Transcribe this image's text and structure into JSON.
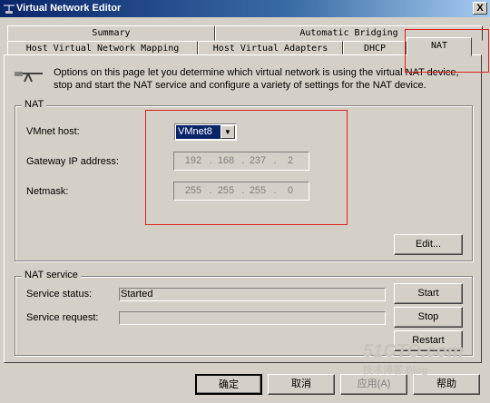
{
  "window": {
    "title": "Virtual Network Editor",
    "close_glyph": "X"
  },
  "tabs_row1": [
    "Summary",
    "Automatic Bridging"
  ],
  "tabs_row2": [
    "Host Virtual Network Mapping",
    "Host Virtual Adapters",
    "DHCP",
    "NAT"
  ],
  "intro": {
    "text": "Options on this page let you determine which virtual network is using the virtual NAT device, stop and start the NAT service and configure a variety of settings for the NAT device."
  },
  "nat_group": {
    "title": "NAT",
    "vmnet_label": "VMnet host:",
    "vmnet_value": "VMnet8",
    "gateway_label": "Gateway IP address:",
    "gateway": [
      "192",
      "168",
      "237",
      "2"
    ],
    "netmask_label": "Netmask:",
    "netmask": [
      "255",
      "255",
      "255",
      "0"
    ],
    "edit_button": "Edit..."
  },
  "service_group": {
    "title": "NAT service",
    "status_label": "Service status:",
    "status_value": "Started",
    "request_label": "Service request:",
    "request_value": "",
    "start_button": "Start",
    "stop_button": "Stop",
    "restart_button": "Restart"
  },
  "footer": {
    "ok": "确定",
    "cancel": "取消",
    "apply": "应用(A)",
    "help": "帮助"
  },
  "watermark": {
    "line1": "51CTO.com",
    "line2": "技术博客 Blog"
  },
  "colors": {
    "face": "#d4d0c8",
    "title_start": "#0a246a",
    "selection": "#0a246a",
    "annotation": "#e02020"
  }
}
